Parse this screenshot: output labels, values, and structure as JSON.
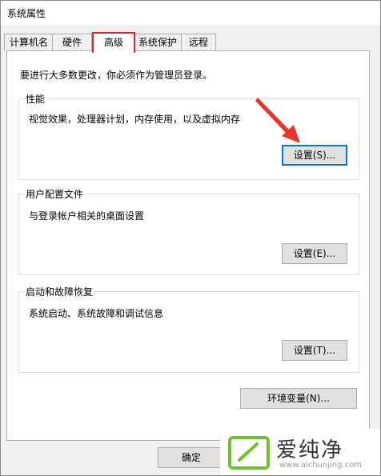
{
  "window": {
    "title": "系统属性"
  },
  "tabs": [
    {
      "label": "计算机名"
    },
    {
      "label": "硬件"
    },
    {
      "label": "高级"
    },
    {
      "label": "系统保护"
    },
    {
      "label": "远程"
    }
  ],
  "active_tab": "高级",
  "notice": "要进行大多数更改，你必须作为管理员登录。",
  "performance": {
    "title": "性能",
    "description": "视觉效果，处理器计划，内存使用，以及虚拟内存",
    "button": "设置(S)..."
  },
  "user_profiles": {
    "title": "用户配置文件",
    "description": "与登录帐户相关的桌面设置",
    "button": "设置(E)..."
  },
  "startup_recovery": {
    "title": "启动和故障恢复",
    "description": "系统启动、系统故障和调试信息",
    "button": "设置(T)..."
  },
  "env_vars_button": "环境变量(N)...",
  "ok_button": "确定",
  "watermark": {
    "text": "爱纯净",
    "url": "www.aichunjing.com"
  },
  "colors": {
    "tab_highlight": "#e0242a",
    "arrow": "#e8352c",
    "focus": "#0078d7",
    "watermark_green": "#6fc22e"
  }
}
